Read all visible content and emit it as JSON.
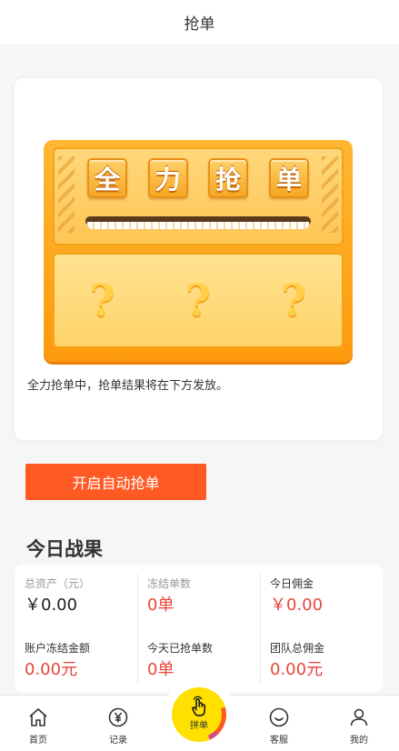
{
  "header": {
    "title": "抢单"
  },
  "machine": {
    "tiles": [
      "全",
      "力",
      "抢",
      "单"
    ],
    "mystery": [
      "?",
      "?",
      "?"
    ]
  },
  "card": {
    "note": "全力抢单中，抢单结果将在下方发放。"
  },
  "auto_button": {
    "label": "开启自动抢单"
  },
  "results": {
    "title": "今日战果",
    "stats": [
      {
        "label": "总资产（元）",
        "value": "￥0.00",
        "value_color": "#222222"
      },
      {
        "label": "冻结单数",
        "value": "0单",
        "value_color": "#e8453c"
      },
      {
        "label": "今日佣金",
        "value": "￥0.00",
        "value_color": "#e8453c"
      },
      {
        "label": "账户冻结金额",
        "value": "0.00元",
        "value_color": "#e8453c"
      },
      {
        "label": "今天已抢单数",
        "value": "0单",
        "value_color": "#e8453c"
      },
      {
        "label": "团队总佣金",
        "value": "0.00元",
        "value_color": "#e8453c"
      }
    ]
  },
  "tabbar": {
    "items": [
      {
        "label": "首页",
        "icon": "home-icon"
      },
      {
        "label": "记录",
        "icon": "yen-icon"
      },
      {
        "label": "拼单",
        "icon": "tap-hand-icon"
      },
      {
        "label": "客服",
        "icon": "chat-icon"
      },
      {
        "label": "我的",
        "icon": "user-icon"
      }
    ]
  },
  "colors": {
    "accent": "#ff5a24",
    "value_red": "#e8453c",
    "machine": "#ff9a0c"
  }
}
